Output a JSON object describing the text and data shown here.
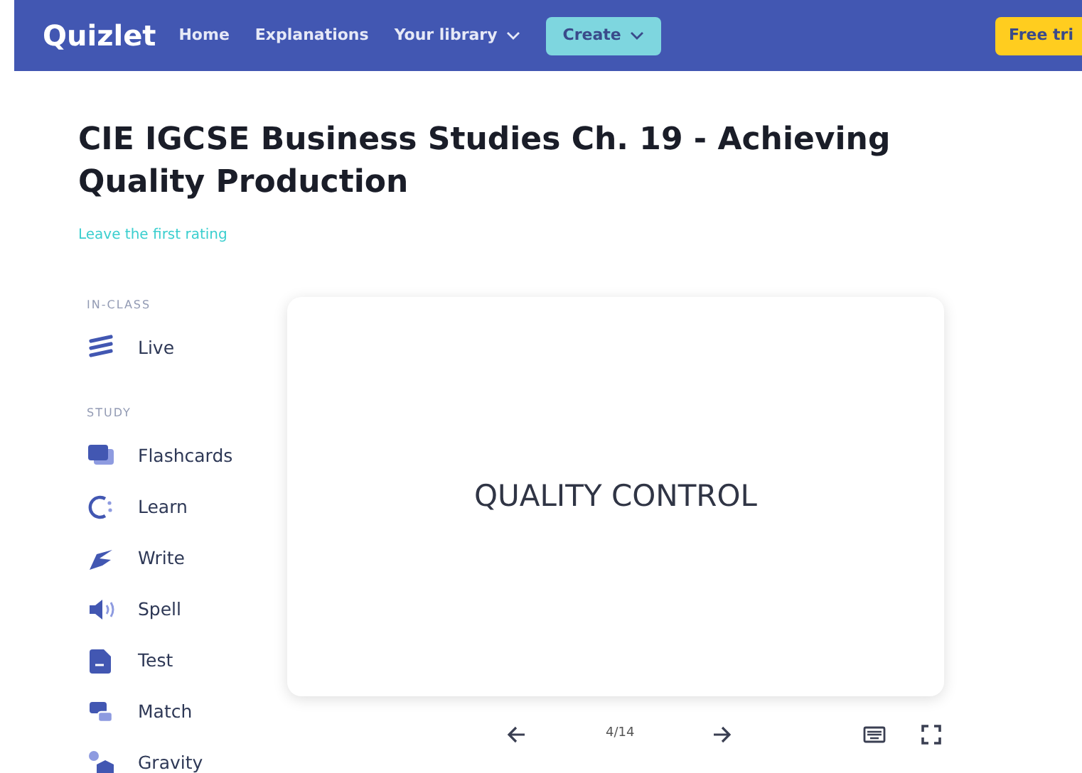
{
  "navbar": {
    "logo": "Quizlet",
    "links": [
      "Home",
      "Explanations",
      "Your library"
    ],
    "create": "Create",
    "trial": "Free tri"
  },
  "set": {
    "title": "CIE IGCSE Business Studies Ch. 19 - Achieving Quality Production",
    "rating": "Leave the first rating"
  },
  "sidebar": [
    {
      "heading": "IN-CLASS",
      "items": [
        {
          "label": "Live",
          "kind": "live"
        }
      ]
    },
    {
      "heading": "STUDY",
      "items": [
        {
          "label": "Flashcards",
          "kind": "flashcards"
        },
        {
          "label": "Learn",
          "kind": "learn"
        },
        {
          "label": "Write",
          "kind": "write"
        },
        {
          "label": "Spell",
          "kind": "spell"
        },
        {
          "label": "Test",
          "kind": "test"
        },
        {
          "label": "Match",
          "kind": "match"
        },
        {
          "label": "Gravity",
          "kind": "gravity"
        }
      ]
    }
  ],
  "card": {
    "term": "QUALITY CONTROL",
    "counter": "4/14"
  }
}
